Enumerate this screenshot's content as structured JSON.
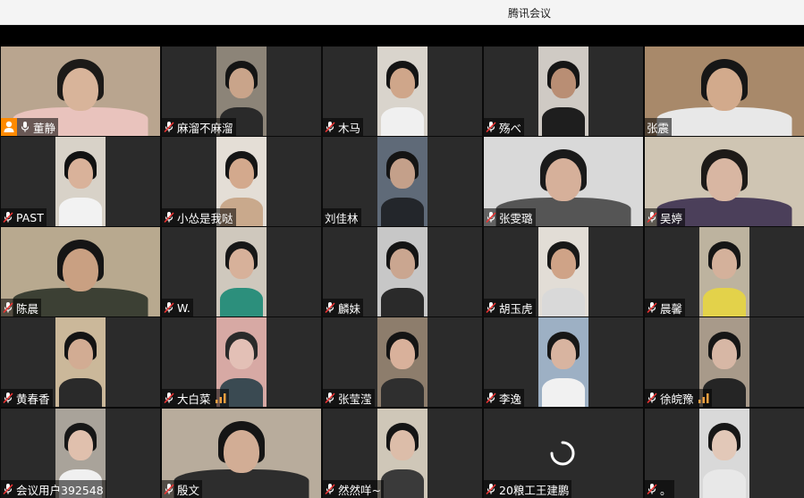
{
  "window": {
    "title": "腾讯会议"
  },
  "participants": [
    {
      "name": "董静",
      "row": 0,
      "col": 0,
      "host": true,
      "mic": "on",
      "video": "full",
      "bg": "#b9a58f",
      "skin": "#d8b49a",
      "hair": "#1c1a18",
      "cloth": "#e9c3bd",
      "active": true
    },
    {
      "name": "麻溜不麻溜",
      "row": 0,
      "col": 1,
      "mic": "muted",
      "video": "narrow",
      "bg": "#8c8478",
      "skin": "#c9a48a",
      "hair": "#141414",
      "cloth": "#2a2a2a"
    },
    {
      "name": "木马",
      "row": 0,
      "col": 2,
      "mic": "muted",
      "video": "narrow",
      "bg": "#d9d4cc",
      "skin": "#cfa68a",
      "hair": "#141414",
      "cloth": "#f0f0f0"
    },
    {
      "name": "殇べ",
      "row": 0,
      "col": 3,
      "mic": "muted",
      "video": "narrow",
      "bg": "#cfcac4",
      "skin": "#b98e74",
      "hair": "#151515",
      "cloth": "#1e1e1e"
    },
    {
      "name": "张震",
      "row": 0,
      "col": 4,
      "mic": "none",
      "video": "full",
      "bg": "#a8896a",
      "skin": "#d2aa8c",
      "hair": "#161616",
      "cloth": "#e8e8e8"
    },
    {
      "name": "PAST",
      "row": 1,
      "col": 0,
      "mic": "muted",
      "video": "narrow",
      "bg": "#d8d2c8",
      "skin": "#d9b29a",
      "hair": "#121212",
      "cloth": "#f2f2f2"
    },
    {
      "name": "小怂是我哒",
      "row": 1,
      "col": 1,
      "mic": "muted",
      "video": "narrow",
      "bg": "#e4ded6",
      "skin": "#d3a98d",
      "hair": "#151515",
      "cloth": "#c9a98c"
    },
    {
      "name": "刘佳林",
      "row": 1,
      "col": 2,
      "mic": "none",
      "video": "narrow",
      "bg": "#5f6a78",
      "skin": "#c4a08a",
      "hair": "#141414",
      "cloth": "#23262b"
    },
    {
      "name": "张雯璐",
      "row": 1,
      "col": 3,
      "mic": "muted",
      "video": "full",
      "bg": "#d9d9d9",
      "skin": "#d6b09a",
      "hair": "#1a1a1a",
      "cloth": "#555555"
    },
    {
      "name": "吴婷",
      "row": 1,
      "col": 4,
      "mic": "muted",
      "video": "full",
      "bg": "#cfc5b3",
      "skin": "#d8b6a2",
      "hair": "#1d1a18",
      "cloth": "#4b3f5a"
    },
    {
      "name": "陈晨",
      "row": 2,
      "col": 0,
      "mic": "muted",
      "video": "full",
      "bg": "#b8a98f",
      "skin": "#c9a082",
      "hair": "#151515",
      "cloth": "#3c4034"
    },
    {
      "name": "W.",
      "row": 2,
      "col": 1,
      "mic": "muted",
      "video": "narrow",
      "bg": "#cfc8bd",
      "skin": "#d7b19a",
      "hair": "#171717",
      "cloth": "#2c8f7c"
    },
    {
      "name": "麟妹",
      "row": 2,
      "col": 2,
      "mic": "muted",
      "video": "narrow",
      "bg": "#c7c7c7",
      "skin": "#caa690",
      "hair": "#141414",
      "cloth": "#2a2a2a"
    },
    {
      "name": "胡玉虎",
      "row": 2,
      "col": 3,
      "mic": "muted",
      "video": "narrow",
      "bg": "#e2ddd6",
      "skin": "#cfa387",
      "hair": "#181818",
      "cloth": "#d9d9d9"
    },
    {
      "name": "晨馨",
      "row": 2,
      "col": 4,
      "mic": "muted",
      "video": "narrow",
      "bg": "#bdb39f",
      "skin": "#d4b19b",
      "hair": "#161616",
      "cloth": "#e3d24a"
    },
    {
      "name": "黄春香",
      "row": 3,
      "col": 0,
      "mic": "muted",
      "video": "narrow",
      "bg": "#cbb89a",
      "skin": "#d2ac93",
      "hair": "#141414",
      "cloth": "#2a2a2a"
    },
    {
      "name": "大白菜",
      "row": 3,
      "col": 1,
      "mic": "muted",
      "video": "narrow",
      "signal": true,
      "bg": "#d7a9a4",
      "skin": "#e3c0b6",
      "hair": "#2a2a2a",
      "cloth": "#3a4a52"
    },
    {
      "name": "张莹滢",
      "row": 3,
      "col": 2,
      "mic": "muted",
      "video": "narrow",
      "bg": "#8d7d6c",
      "skin": "#d9b19b",
      "hair": "#141414",
      "cloth": "#2f2f2f"
    },
    {
      "name": "李逸",
      "row": 3,
      "col": 3,
      "mic": "muted",
      "video": "narrow",
      "bg": "#9db0c4",
      "skin": "#d8b4a0",
      "hair": "#171717",
      "cloth": "#f1f1f1"
    },
    {
      "name": "徐皖豫",
      "row": 3,
      "col": 4,
      "mic": "muted",
      "video": "narrow",
      "signal": true,
      "bg": "#a89a8a",
      "skin": "#d7b7a5",
      "hair": "#161616",
      "cloth": "#252525"
    },
    {
      "name": "会议用户392548",
      "row": 4,
      "col": 0,
      "mic": "muted",
      "video": "narrow",
      "bg": "#a9a39a",
      "skin": "#e0c0ad",
      "hair": "#171717",
      "cloth": "#f0f0f0"
    },
    {
      "name": "殷文",
      "row": 4,
      "col": 1,
      "mic": "muted",
      "video": "full",
      "bg": "#b8ac9c",
      "skin": "#d2ad95",
      "hair": "#151515",
      "cloth": "#2d2d2d"
    },
    {
      "name": "然然咩~",
      "row": 4,
      "col": 2,
      "mic": "muted",
      "video": "narrow",
      "bg": "#cfc7b8",
      "skin": "#dcbda9",
      "hair": "#151515",
      "cloth": "#3a3a3a"
    },
    {
      "name": "20粮工王建鹏",
      "row": 4,
      "col": 3,
      "mic": "muted",
      "video": "loading",
      "bg": "#2b2b2b",
      "skin": "#000",
      "hair": "#000",
      "cloth": "#000"
    },
    {
      "name": "。",
      "row": 4,
      "col": 4,
      "mic": "muted",
      "video": "narrow",
      "bg": "#d9d9d9",
      "skin": "#e2c8b8",
      "hair": "#171717",
      "cloth": "#e8e8e8"
    }
  ]
}
